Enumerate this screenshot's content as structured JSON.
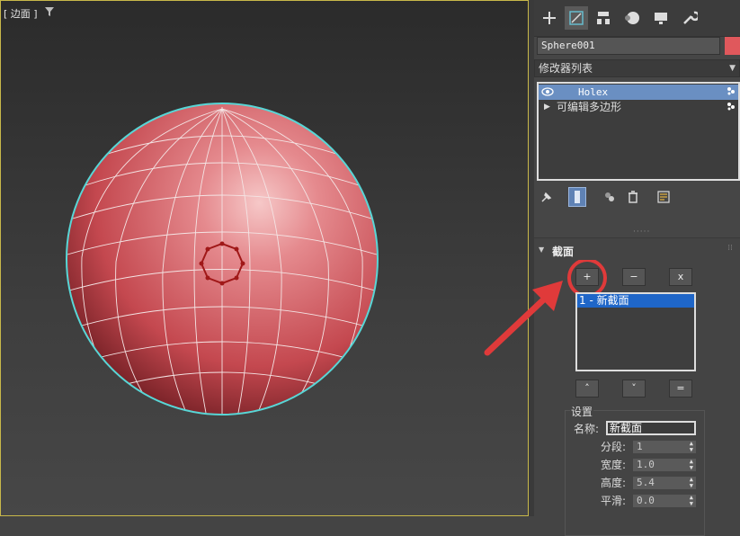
{
  "viewport": {
    "label": "[ 边面 ]",
    "filter_icon": "funnel-icon"
  },
  "panel": {
    "tabs": [
      {
        "icon": "plus-icon"
      },
      {
        "icon": "modify-icon"
      },
      {
        "icon": "hierarchy-icon"
      },
      {
        "icon": "motion-icon"
      },
      {
        "icon": "display-icon"
      },
      {
        "icon": "wrench-icon"
      }
    ],
    "object_name": "Sphere001",
    "object_color": "#e0585c",
    "modifier_list": "修改器列表",
    "stack": [
      {
        "label": "Holex",
        "selected": true
      },
      {
        "label": "可编辑多边形",
        "selected": false
      }
    ],
    "rollout": {
      "title": "截面",
      "add_label": "+",
      "remove_label": "−",
      "clear_label": "x",
      "sections": [
        "1 - 新截面"
      ],
      "up_label": "˄",
      "down_label": "˅",
      "equal_label": "="
    },
    "settings": {
      "legend": "设置",
      "name_label": "名称:",
      "name_value": "新截面",
      "segments_label": "分段:",
      "segments_value": "1",
      "width_label": "宽度:",
      "width_value": "1.0",
      "height_label": "高度:",
      "height_value": "5.4",
      "smooth_label": "平滑:",
      "smooth_value": "0.0"
    }
  },
  "colors": {
    "highlight": "#e03a3a",
    "selection_blue": "#1f66c8",
    "sphere": "#c8505a"
  }
}
